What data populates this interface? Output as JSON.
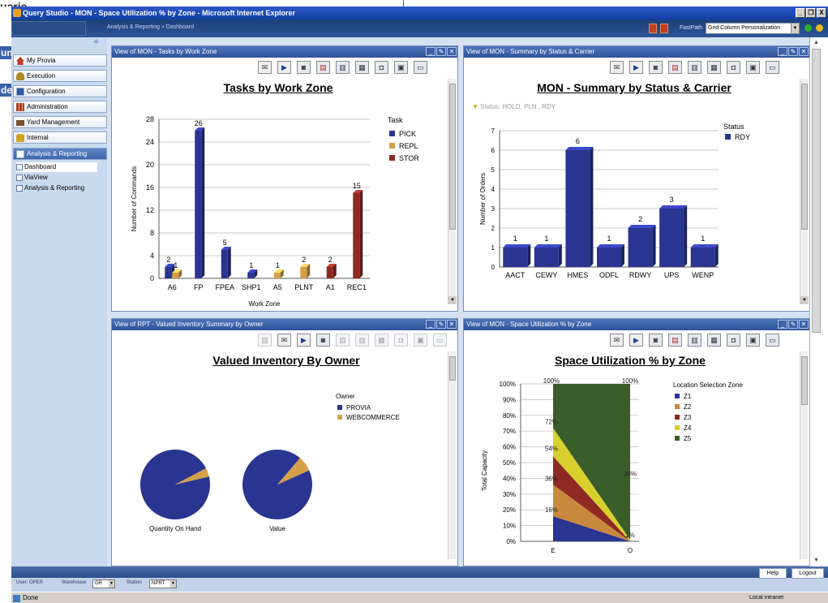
{
  "window": {
    "title": "Query Studio - MON - Space Utilization % by Zone - Microsoft Internet Explorer",
    "buttons": [
      "_",
      "❐",
      "X"
    ],
    "edge_fragment": "uerie"
  },
  "app": {
    "breadcrumb": "Analysis & Reporting » Dashboard",
    "fastpath_label": "FastPath",
    "fastpath_value": "Grid Column Personalization",
    "left_edge_letters": [
      "un",
      "de"
    ]
  },
  "sidebar": {
    "collapse_glyph": "⟡",
    "items": [
      {
        "label": "My Provia",
        "icon": "house-icon",
        "color": "#c0392b"
      },
      {
        "label": "Execution",
        "icon": "people-icon",
        "color": "#b08a20"
      },
      {
        "label": "Configuration",
        "icon": "monitor-icon",
        "color": "#2a5aa8"
      },
      {
        "label": "Administration",
        "icon": "grid-icon",
        "color": "#b04020"
      },
      {
        "label": "Yard Management",
        "icon": "truck-icon",
        "color": "#7a5030"
      },
      {
        "label": "Internal",
        "icon": "lock-icon",
        "color": "#d0a020"
      },
      {
        "label": "Analysis & Reporting",
        "icon": "report-icon",
        "color": "#ffffff"
      }
    ],
    "subitems": [
      "Dashboard",
      "ViaView",
      "Analysis & Reporting"
    ]
  },
  "panels": {
    "tasks": {
      "header": "View of MON - Tasks by Work Zone",
      "chart_data": {
        "type": "bar",
        "title": "Tasks by Work Zone",
        "xlabel": "Work Zone",
        "ylabel": "Number of Commands",
        "ylim": [
          0,
          28
        ],
        "yticks": [
          0,
          4,
          8,
          12,
          16,
          20,
          24,
          28
        ],
        "legend_title": "Task",
        "legend_position": "right",
        "categories": [
          "A6",
          "FP",
          "FPEA",
          "SHP1",
          "A5",
          "PLNT",
          "A1",
          "REC1"
        ],
        "series": [
          {
            "name": "PICK",
            "color": "#2a3591",
            "values": [
              2,
              26,
              5,
              1,
              null,
              null,
              null,
              null
            ]
          },
          {
            "name": "REPL",
            "color": "#d4a04a",
            "values": [
              1,
              null,
              null,
              null,
              1,
              2,
              null,
              null
            ]
          },
          {
            "name": "STOR",
            "color": "#8e2a22",
            "values": [
              null,
              null,
              null,
              null,
              null,
              null,
              2,
              15
            ]
          }
        ]
      }
    },
    "summary": {
      "header": "View of MON - Summary by Status & Carrier",
      "filter": "Status: HOLD, PLN , RDY",
      "chart_data": {
        "type": "bar",
        "title": "MON - Summary by Status & Carrier",
        "ylabel": "Number of Orders",
        "ylim": [
          0,
          7
        ],
        "yticks": [
          0,
          1,
          2,
          3,
          4,
          5,
          6,
          7
        ],
        "legend_title": "Status",
        "legend_position": "right",
        "categories": [
          "AACT",
          "CEWY",
          "HMES",
          "ODFL",
          "RDWY",
          "UPS",
          "WENP"
        ],
        "series": [
          {
            "name": "RDY",
            "color": "#2a3591",
            "values": [
              1,
              1,
              6,
              1,
              2,
              3,
              1
            ]
          }
        ]
      }
    },
    "inventory": {
      "header": "View of RPT - Valued Inventory Summary by Owner",
      "chart_data": {
        "type": "pie",
        "title": "Valued Inventory By Owner",
        "legend_title": "Owner",
        "legend_position": "top-right",
        "series_names": [
          "PROVIA",
          "WEBCOMMERCE"
        ],
        "colors": [
          "#2a3591",
          "#d4a04a"
        ],
        "pies": [
          {
            "label": "Quantity On Hand",
            "values": [
              96,
              4
            ]
          },
          {
            "label": "Value",
            "values": [
              93,
              7
            ]
          }
        ]
      }
    },
    "space": {
      "header": "View of MON - Space Utilization % by Zone",
      "chart_data": {
        "type": "area",
        "title": "Space Utilization % by Zone",
        "ylabel": "Total Capacity",
        "ylim": [
          0,
          100
        ],
        "ytick_labels": [
          "0%",
          "10%",
          "20%",
          "30%",
          "40%",
          "50%",
          "60%",
          "70%",
          "80%",
          "90%",
          "100%"
        ],
        "legend_title": "Location Selection Zone",
        "legend_position": "right",
        "categories": [
          "E",
          "O"
        ],
        "stacked_percent": true,
        "series": [
          {
            "name": "Z1",
            "color": "#2a3591",
            "values": [
              16,
              0
            ]
          },
          {
            "name": "Z2",
            "color": "#c8893e",
            "values": [
              20,
              0
            ]
          },
          {
            "name": "Z3",
            "color": "#8e2a22",
            "values": [
              18,
              0
            ]
          },
          {
            "name": "Z4",
            "color": "#d7cf2c",
            "values": [
              18,
              1
            ]
          },
          {
            "name": "Z5",
            "color": "#3a5e2a",
            "values": [
              28,
              99
            ]
          }
        ],
        "point_labels": [
          {
            "text": "16%",
            "cat": 0,
            "value": 20
          },
          {
            "text": "36%",
            "cat": 0,
            "value": 40
          },
          {
            "text": "54%",
            "cat": 0,
            "value": 59
          },
          {
            "text": "72%",
            "cat": 0,
            "value": 76
          },
          {
            "text": "100%",
            "cat": 0,
            "value": 102
          },
          {
            "text": "38%",
            "cat": 1,
            "value": 43
          },
          {
            "text": "1%",
            "cat": 1,
            "value": 4
          },
          {
            "text": "100%",
            "cat": 1,
            "value": 102
          }
        ]
      }
    }
  },
  "bottombar": {
    "user_label": "User: OPER",
    "warehouse_label": "Warehouse",
    "warehouse_value": "GR",
    "station_label": "Station",
    "station_value": "NPRT",
    "help": "Help",
    "logout": "Logout"
  },
  "ie_status": {
    "text": "Done",
    "zone": "Local intranet"
  }
}
